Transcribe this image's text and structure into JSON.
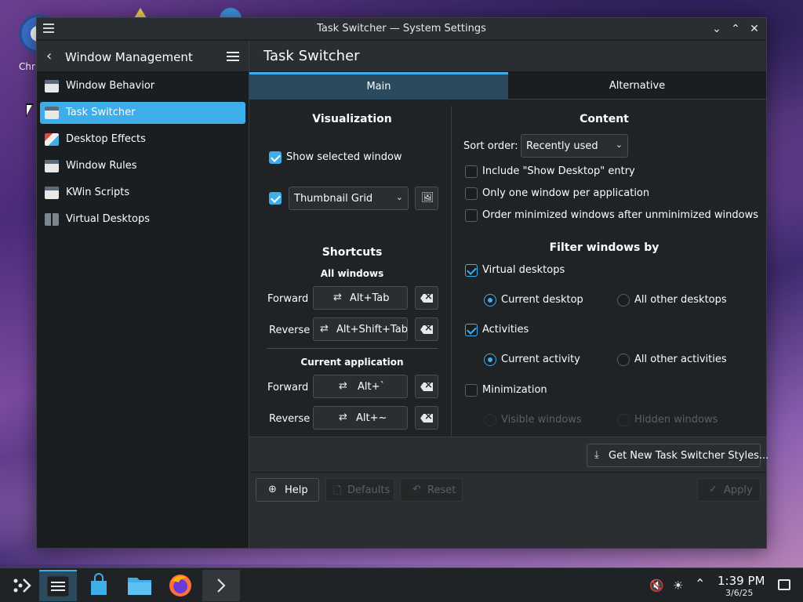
{
  "desktop": {
    "icon_label": "Chr"
  },
  "window": {
    "title": "Task Switcher — System Settings",
    "controls": {
      "minimize": "⌄",
      "maximize": "⌃",
      "close": "✕"
    }
  },
  "sidebar": {
    "header": "Window Management",
    "items": [
      {
        "label": "Window Behavior",
        "icon": "window-icon"
      },
      {
        "label": "Task Switcher",
        "icon": "task-switcher-icon",
        "active": true
      },
      {
        "label": "Desktop Effects",
        "icon": "desktop-effects-icon"
      },
      {
        "label": "Window Rules",
        "icon": "window-rules-icon"
      },
      {
        "label": "KWin Scripts",
        "icon": "kwin-scripts-icon"
      },
      {
        "label": "Virtual Desktops",
        "icon": "virtual-desktops-icon"
      }
    ]
  },
  "main": {
    "page_title": "Task Switcher",
    "tabs": [
      {
        "label": "Main",
        "active": true
      },
      {
        "label": "Alternative"
      }
    ],
    "visualization": {
      "title": "Visualization",
      "show_selected_window": "Show selected window",
      "layout_value": "Thumbnail Grid"
    },
    "shortcuts": {
      "title": "Shortcuts",
      "all_windows": "All windows",
      "current_application": "Current application",
      "forward": "Forward",
      "reverse": "Reverse",
      "all_forward": "Alt+Tab",
      "all_reverse": "Alt+Shift+Tab",
      "app_forward": "Alt+`",
      "app_reverse": "Alt+~"
    },
    "content": {
      "title": "Content",
      "sort_order_label": "Sort order:",
      "sort_order_value": "Recently used",
      "include_show_desktop": "Include \"Show Desktop\" entry",
      "one_window_per_app": "Only one window per application",
      "order_minimized": "Order minimized windows after unminimized windows"
    },
    "filter": {
      "title": "Filter windows by",
      "virtual_desktops": "Virtual desktops",
      "current_desktop": "Current desktop",
      "all_other_desktops": "All other desktops",
      "activities": "Activities",
      "current_activity": "Current activity",
      "all_other_activities": "All other activities",
      "minimization": "Minimization",
      "visible_windows": "Visible windows",
      "hidden_windows": "Hidden windows"
    },
    "get_new_styles": "Get New Task Switcher Styles...",
    "buttons": {
      "help": "Help",
      "defaults": "Defaults",
      "reset": "Reset",
      "apply": "Apply"
    }
  },
  "taskbar": {
    "clock_time": "1:39 PM",
    "clock_date": "3/6/25"
  },
  "colors": {
    "accent": "#3daee9",
    "window_bg": "#202326",
    "header_bg": "#2a2e32"
  }
}
